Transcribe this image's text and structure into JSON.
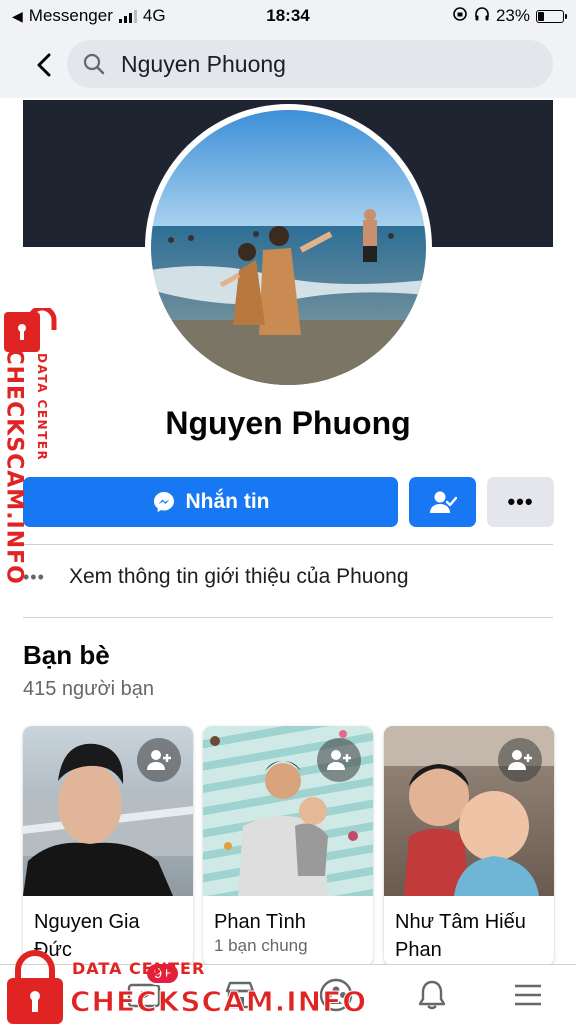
{
  "status_bar": {
    "carrier": "Messenger",
    "network": "4G",
    "time": "18:34",
    "battery": "23%",
    "battery_level": 0.23
  },
  "search": {
    "query": "Nguyen Phuong"
  },
  "profile": {
    "name": "Nguyen Phuong",
    "message_button": "Nhắn tin",
    "about_link": "Xem thông tin giới thiệu của Phuong"
  },
  "friends": {
    "title": "Bạn bè",
    "count": "415 người bạn",
    "items": [
      {
        "name": "Nguyen Gia Đức",
        "mutual": ""
      },
      {
        "name": "Phan Tình",
        "mutual": "1 bạn chung"
      },
      {
        "name": "Như Tâm Hiếu Phan",
        "mutual": ""
      }
    ]
  },
  "bottom_nav": {
    "badge": "9+",
    "icons": [
      "home-icon",
      "video-icon",
      "marketplace-icon",
      "groups-icon",
      "bell-icon",
      "menu-icon"
    ]
  },
  "watermark": {
    "brand": "CHECKSCAM.INFO",
    "sub": "DATA CENTER"
  },
  "colors": {
    "primary": "#1877f2",
    "watermark": "#e02424",
    "cover": "#1f2431"
  }
}
